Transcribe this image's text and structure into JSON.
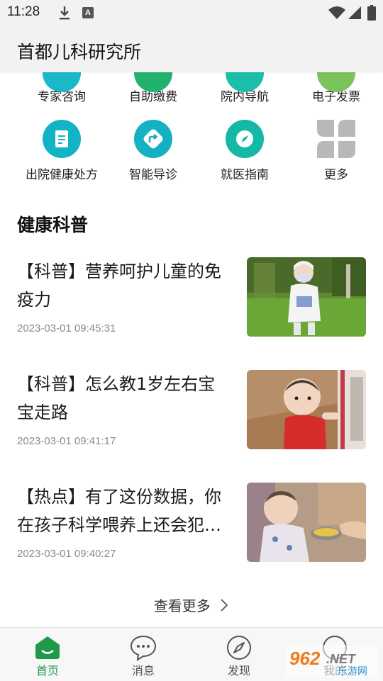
{
  "status_bar": {
    "time": "11:28",
    "notif_icon": "A"
  },
  "header": {
    "title": "首都儿科研究所"
  },
  "services_row1": [
    {
      "label": "专家咨询",
      "color": "#1bb8c9"
    },
    {
      "label": "自助缴费",
      "color": "#21b36e"
    },
    {
      "label": "院内导航",
      "color": "#1bbfa9"
    },
    {
      "label": "电子发票",
      "color": "#7cc35b"
    }
  ],
  "services_row2": [
    {
      "label": "出院健康处方",
      "color": "#12b3c4",
      "icon": "prescription-icon"
    },
    {
      "label": "智能导诊",
      "color": "#14b1c2",
      "icon": "guide-arrow-icon"
    },
    {
      "label": "就医指南",
      "color": "#14b8a6",
      "icon": "compass-icon"
    },
    {
      "label": "更多",
      "color": "#b5b5b5",
      "icon": "grid-more-icon"
    }
  ],
  "section": {
    "title": "健康科普"
  },
  "articles": [
    {
      "title": "【科普】营养呵护儿童的免疫力",
      "time": "2023-03-01 09:45:31"
    },
    {
      "title": "【科普】怎么教1岁左右宝宝走路",
      "time": "2023-03-01 09:41:17"
    },
    {
      "title": "【热点】有了这份数据，你在孩子科学喂养上还会犯错吗",
      "time": "2023-03-01 09:40:27"
    }
  ],
  "more": {
    "label": "查看更多"
  },
  "tabs": [
    {
      "label": "首页",
      "active": true
    },
    {
      "label": "消息",
      "active": false
    },
    {
      "label": "发现",
      "active": false
    },
    {
      "label": "我的",
      "active": false
    }
  ],
  "watermark": {
    "brand": "962.NET",
    "sub": "乐游网"
  },
  "colors": {
    "accent": "#1f9a4a",
    "teal": "#14b1c2"
  }
}
